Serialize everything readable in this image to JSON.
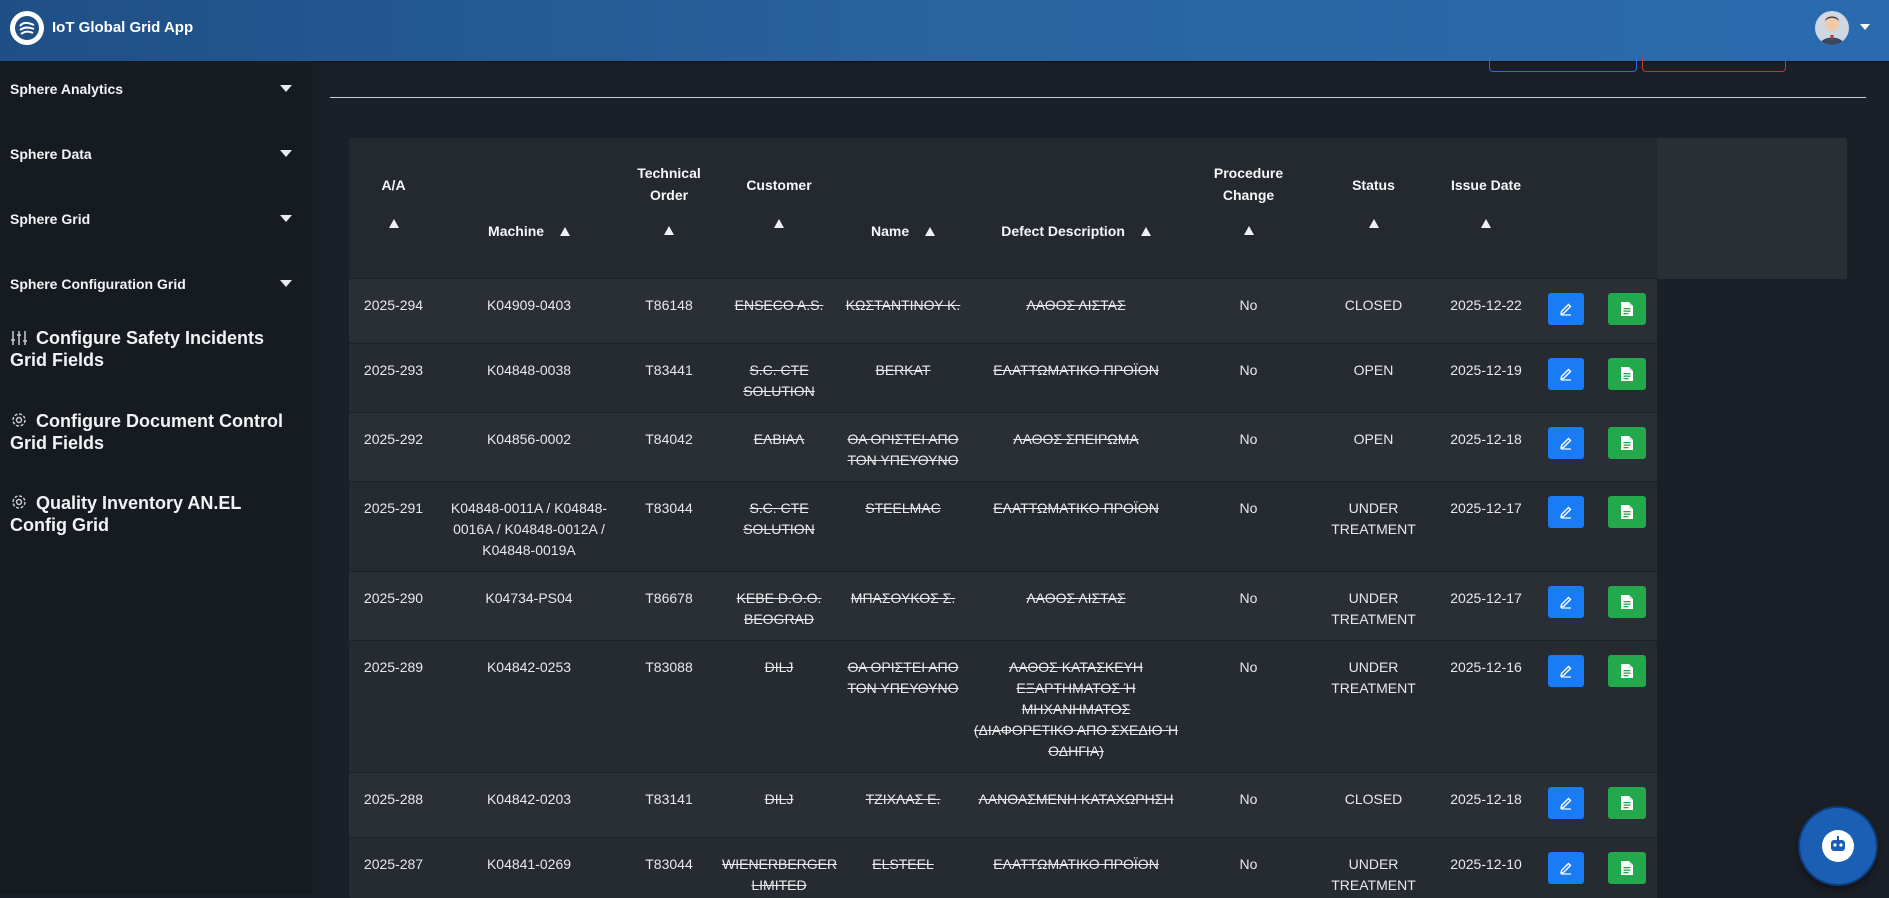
{
  "app": {
    "title": "IoT Global Grid App"
  },
  "sidebar": {
    "dropdowns": [
      {
        "label": "Sphere Analytics"
      },
      {
        "label": "Sphere Data"
      },
      {
        "label": "Sphere Grid"
      },
      {
        "label": "Sphere Configuration Grid"
      }
    ],
    "links": [
      {
        "label": "Configure Safety Incidents Grid Fields",
        "icon": "sliders-icon"
      },
      {
        "label": "Configure Document Control Grid Fields",
        "icon": "gear-icon"
      },
      {
        "label": "Quality Inventory AN.EL Config Grid",
        "icon": "gear-icon"
      }
    ]
  },
  "table": {
    "headers": {
      "aa": "A/A",
      "machine": "Machine",
      "technical_order": "Technical Order",
      "customer": "Customer",
      "name": "Name",
      "defect": "Defect Description",
      "procedure_change": "Procedure Change",
      "status": "Status",
      "issue_date": "Issue Date"
    },
    "rows": [
      {
        "aa": "2025-294",
        "machine": "K04909-0403",
        "technical_order": "T86148",
        "customer": "ENSECO A.S.",
        "name": "ΚΩΣΤΑΝΤΙΝΟΥ Κ.",
        "defect": "ΛΑΘΟΣ ΛΙΣΤΑΣ",
        "procedure_change": "No",
        "status": "CLOSED",
        "issue_date": "2025-12-22"
      },
      {
        "aa": "2025-293",
        "machine": "K04848-0038",
        "technical_order": "T83441",
        "customer": "S.C. CTE SOLUTION",
        "name": "BERKAT",
        "defect": "ΕΛΑΤΤΩΜΑΤΙΚΟ ΠΡΟΪΟΝ",
        "procedure_change": "No",
        "status": "OPEN",
        "issue_date": "2025-12-19"
      },
      {
        "aa": "2025-292",
        "machine": "K04856-0002",
        "technical_order": "T84042",
        "customer": "ΕΛΒΙΑΛ",
        "name": "ΘΑ ΟΡΙΣΤΕΙ ΑΠΟ ΤΟΝ ΥΠΕΥΘΥΝΟ",
        "defect": "ΛΑΘΟΣ ΣΠΕΙΡΩΜΑ",
        "procedure_change": "No",
        "status": "OPEN",
        "issue_date": "2025-12-18"
      },
      {
        "aa": "2025-291",
        "machine": "K04848-0011A / K04848-0016A / K04848-0012A / K04848-0019A",
        "technical_order": "T83044",
        "customer": "S.C. CTE SOLUTION",
        "name": "STEELMAC",
        "defect": "ΕΛΑΤΤΩΜΑΤΙΚΟ ΠΡΟΪΟΝ",
        "procedure_change": "No",
        "status": "UNDER TREATMENT",
        "issue_date": "2025-12-17"
      },
      {
        "aa": "2025-290",
        "machine": "K04734-PS04",
        "technical_order": "T86678",
        "customer": "KEBE D.O.O. BEOGRAD",
        "name": "ΜΠΑΣΟΥΚΟΣ Σ.",
        "defect": "ΛΑΘΟΣ ΛΙΣΤΑΣ",
        "procedure_change": "No",
        "status": "UNDER TREATMENT",
        "issue_date": "2025-12-17"
      },
      {
        "aa": "2025-289",
        "machine": "K04842-0253",
        "technical_order": "T83088",
        "customer": "DILJ",
        "name": "ΘΑ ΟΡΙΣΤΕΙ ΑΠΟ ΤΟΝ ΥΠΕΥΘΥΝΟ",
        "defect": "ΛΑΘΟΣ ΚΑΤΑΣΚΕΥΗ ΕΞΑΡΤΗΜΑΤΟΣ Ή ΜΗΧΑΝΗΜΑΤΟΣ (ΔΙΑΦΟΡΕΤΙΚΟ ΑΠΟ ΣΧΕΔΙΟ Ή ΟΔΗΓΙΑ)",
        "procedure_change": "No",
        "status": "UNDER TREATMENT",
        "issue_date": "2025-12-16"
      },
      {
        "aa": "2025-288",
        "machine": "K04842-0203",
        "technical_order": "T83141",
        "customer": "DILJ",
        "name": "ΤΖΙΧΛΑΣ Ε.",
        "defect": "ΛΑΝΘΑΣΜΕΝΗ ΚΑΤΑΧΩΡΗΣΗ",
        "procedure_change": "No",
        "status": "CLOSED",
        "issue_date": "2025-12-18"
      },
      {
        "aa": "2025-287",
        "machine": "K04841-0269",
        "technical_order": "T83044",
        "customer": "WIENERBERGER LIMITED",
        "name": "ELSTEEL",
        "defect": "ΕΛΑΤΤΩΜΑΤΙΚΟ ΠΡΟΪΟΝ",
        "procedure_change": "No",
        "status": "UNDER TREATMENT",
        "issue_date": "2025-12-10"
      }
    ]
  },
  "colors": {
    "topbar": "#2a639f",
    "edit_button": "#1a7cf5",
    "doc_button": "#23a84b"
  }
}
